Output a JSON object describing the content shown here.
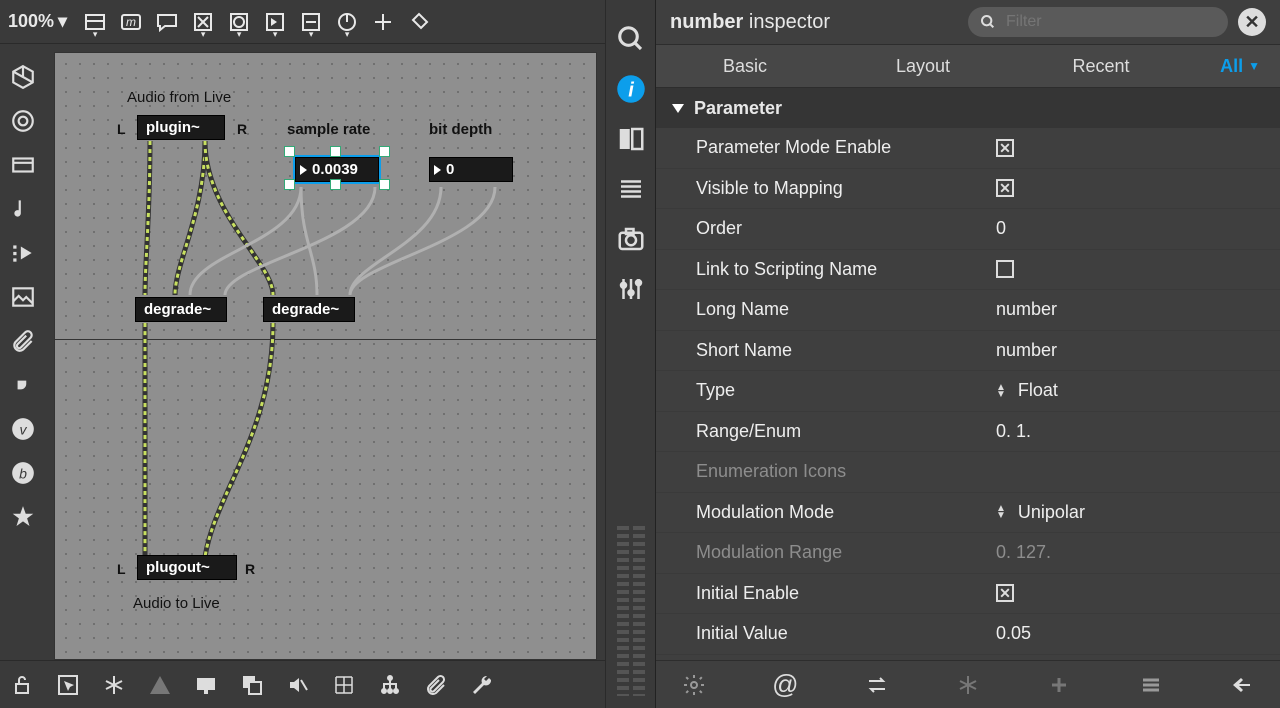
{
  "zoom": "100%",
  "patcher": {
    "labels": {
      "audio_from": "Audio from Live",
      "audio_to": "Audio to Live",
      "sample_rate": "sample rate",
      "bit_depth": "bit depth",
      "L": "L",
      "R": "R"
    },
    "nodes": {
      "plugin": "plugin~",
      "degrade1": "degrade~",
      "degrade2": "degrade~",
      "plugout": "plugout~",
      "num_sr": "0.0039",
      "num_bd": "0"
    }
  },
  "inspector": {
    "title_bold": "number",
    "title_rest": "inspector",
    "search_placeholder": "Filter",
    "tabs": {
      "basic": "Basic",
      "layout": "Layout",
      "recent": "Recent",
      "all": "All"
    },
    "section": "Parameter",
    "rows": [
      {
        "k": "Parameter Mode Enable",
        "type": "check",
        "v": true
      },
      {
        "k": "Visible to Mapping",
        "type": "check",
        "v": true
      },
      {
        "k": "Order",
        "type": "text",
        "v": "0"
      },
      {
        "k": "Link to Scripting Name",
        "type": "check",
        "v": false
      },
      {
        "k": "Long Name",
        "type": "text",
        "v": "number"
      },
      {
        "k": "Short Name",
        "type": "text",
        "v": "number"
      },
      {
        "k": "Type",
        "type": "enum",
        "v": "Float"
      },
      {
        "k": "Range/Enum",
        "type": "text",
        "v": "0. 1."
      },
      {
        "k": "Enumeration Icons",
        "type": "text",
        "v": "",
        "dim": true
      },
      {
        "k": "Modulation Mode",
        "type": "enum",
        "v": "Unipolar"
      },
      {
        "k": "Modulation Range",
        "type": "text",
        "v": "0. 127.",
        "dim": true
      },
      {
        "k": "Initial Enable",
        "type": "check",
        "v": true
      },
      {
        "k": "Initial Value",
        "type": "text",
        "v": "0.05"
      }
    ]
  }
}
